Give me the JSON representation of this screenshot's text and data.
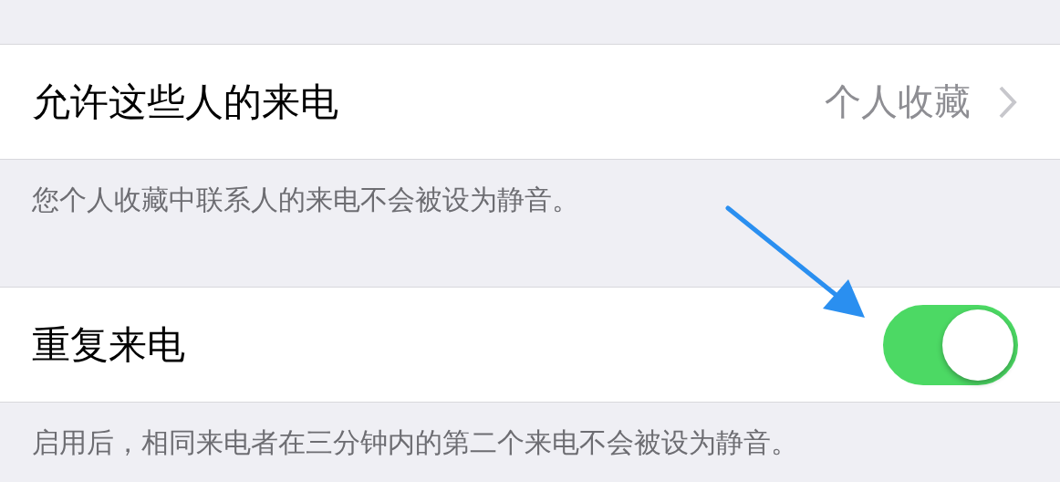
{
  "sections": [
    {
      "row": {
        "kind": "link",
        "label": "允许这些人的来电",
        "value": "个人收藏"
      },
      "footer": "您个人收藏中联系人的来电不会被设为静音。"
    },
    {
      "row": {
        "kind": "toggle",
        "label": "重复来电",
        "on": true
      },
      "footer": "启用后，相同来电者在三分钟内的第二个来电不会被设为静音。"
    }
  ]
}
